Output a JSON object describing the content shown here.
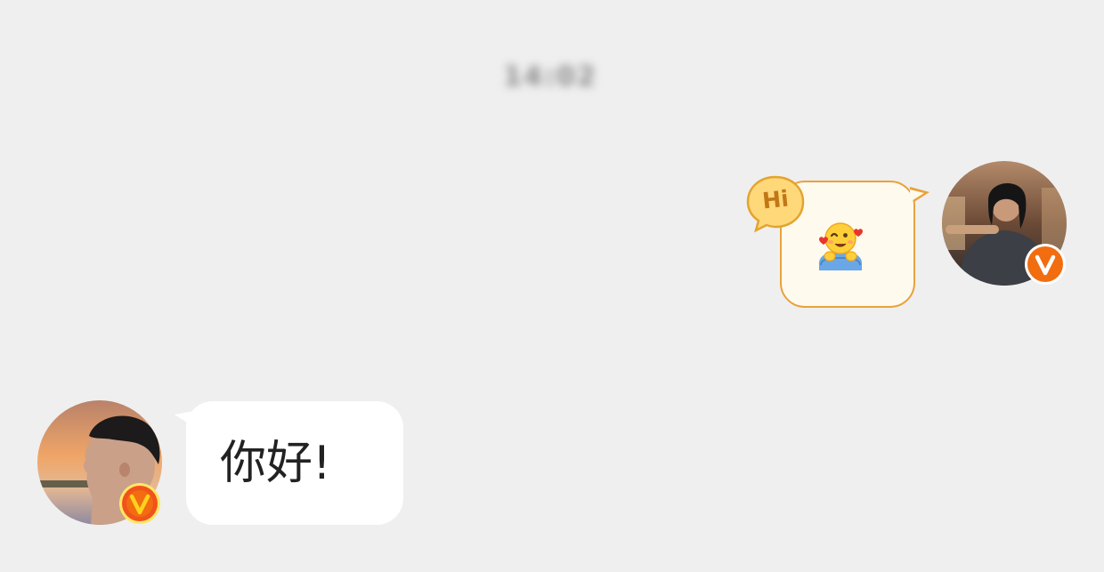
{
  "chat": {
    "header_timestamp": "14:02",
    "messages": [
      {
        "side": "right",
        "type": "sticker",
        "sticker_badge_text": "Hi",
        "sticker_icon": "hugging-face-hearts-icon",
        "sender_badge_icon": "verified-v-badge-icon"
      },
      {
        "side": "left",
        "type": "text",
        "text": "你好!",
        "sender_badge_icon": "verified-v-badge-icon"
      }
    ]
  },
  "colors": {
    "background": "#efefef",
    "sticker_bubble_border": "#e9a23a",
    "sticker_bubble_fill": "#fffaee",
    "incoming_bubble_fill": "#ffffff",
    "badge_orange": "#f26c10",
    "badge_yellow": "#ffd21e"
  }
}
